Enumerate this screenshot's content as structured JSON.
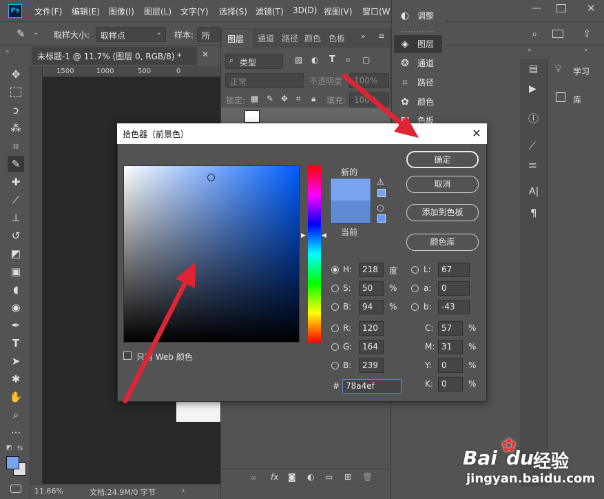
{
  "app": {
    "logo": "Ps"
  },
  "menubar": {
    "items": [
      "文件(F)",
      "编辑(E)",
      "图像(I)",
      "图层(L)",
      "文字(Y)",
      "选择(S)",
      "滤镜(T)",
      "3D(D)",
      "视图(V)",
      "窗口(W"
    ]
  },
  "options": {
    "sample_size_label": "取样大小:",
    "sample_size_value": "取样点",
    "sample_label": "样本:",
    "sample_value": "所有"
  },
  "document": {
    "tab_title": "未标题-1 @ 11.7% (图层 0, RGB/8) *",
    "ruler_ticks": [
      "1500",
      "1000",
      "500",
      "0"
    ],
    "zoom": "11.66%",
    "doc_info": "文档:24.9M/0 字节"
  },
  "layers_panel": {
    "tabs": [
      "图层",
      "通道",
      "路径",
      "颜色",
      "色板"
    ],
    "search_placeholder": "类型",
    "blend_mode": "正常",
    "opacity_label": "不透明度",
    "opacity_value": "100%",
    "lock_label": "锁定:",
    "fill_label": "填充:",
    "fill_value": "100%"
  },
  "right_dock": {
    "items": [
      "调整",
      "图层",
      "通道",
      "路径",
      "颜色",
      "色板"
    ]
  },
  "learn_dock": {
    "items": [
      "学习",
      "库"
    ]
  },
  "color_picker": {
    "title": "拾色器（前景色）",
    "new_label": "新的",
    "current_label": "当前",
    "new_color": "#78a4ef",
    "current_color": "#5e8ad6",
    "hue_deg": 218,
    "buttons": {
      "ok": "确定",
      "cancel": "取消",
      "add_swatch": "添加到色板",
      "libraries": "颜色库"
    },
    "web_only": "只有 Web 颜色",
    "hsb": {
      "h_label": "H:",
      "h": "218",
      "h_unit": "度",
      "s_label": "S:",
      "s": "50",
      "s_unit": "%",
      "b_label": "B:",
      "b": "94",
      "b_unit": "%"
    },
    "rgb": {
      "r_label": "R:",
      "r": "120",
      "g_label": "G:",
      "g": "164",
      "b_label": "B:",
      "b": "239"
    },
    "lab": {
      "l_label": "L:",
      "l": "67",
      "a_label": "a:",
      "a": "0",
      "b_label": "b:",
      "b": "-43"
    },
    "cmyk": {
      "c_label": "C:",
      "c": "57",
      "m_label": "M:",
      "m": "31",
      "y_label": "Y:",
      "y": "0",
      "k_label": "K:",
      "k": "0",
      "unit": "%"
    },
    "hex_label": "#",
    "hex": "78a4ef"
  },
  "watermark": {
    "brand": "Bai",
    "paw": "du",
    "chinese": "经验",
    "url": "jingyan.baidu.com"
  },
  "colors": {
    "arrow": "#e02434",
    "fg_swatch": "#78a4ef",
    "bg_swatch": "#e0e0e0"
  }
}
